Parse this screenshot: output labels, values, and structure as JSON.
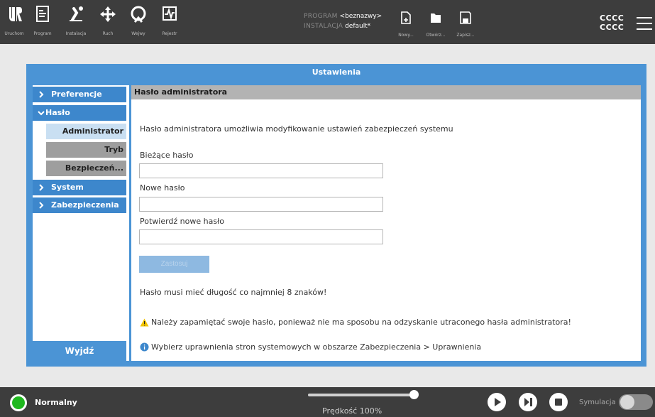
{
  "topbar": {
    "nav": [
      {
        "label": "Uruchom",
        "icon": "robot-logo-icon"
      },
      {
        "label": "Program",
        "icon": "program-icon"
      },
      {
        "label": "Instalacja",
        "icon": "installation-icon"
      },
      {
        "label": "Ruch",
        "icon": "move-icon"
      },
      {
        "label": "Wejwy",
        "icon": "io-icon"
      },
      {
        "label": "Rejestr",
        "icon": "log-icon"
      }
    ],
    "program_key": "PROGRAM",
    "program_value": "<beznazwy>",
    "installation_key": "INSTALACJA",
    "installation_value": "default*",
    "file_buttons": [
      {
        "label": "Nowy...",
        "icon": "new-file-icon"
      },
      {
        "label": "Otwórz...",
        "icon": "open-folder-icon"
      },
      {
        "label": "Zapisz...",
        "icon": "save-icon"
      }
    ],
    "user_line1": "CCCC",
    "user_line2": "CCCC"
  },
  "dialog": {
    "title": "Ustawienia",
    "sidebar": {
      "items": [
        {
          "label": "Preferencje",
          "expanded": false
        },
        {
          "label": "Hasło",
          "expanded": true
        },
        {
          "label": "System",
          "expanded": false
        },
        {
          "label": "Zabezpieczenia",
          "expanded": false
        }
      ],
      "subitems": [
        "Administrator",
        "Tryb",
        "Bezpieczeń..."
      ],
      "active_subitem": "Administrator",
      "exit_label": "Wyjdź"
    },
    "content": {
      "header": "Hasło administratora",
      "description": "Hasło administratora umożliwia modyfikowanie ustawień zabezpieczeń systemu",
      "current_password_label": "Bieżące hasło",
      "current_password_value": "",
      "new_password_label": "Nowe hasło",
      "new_password_value": "",
      "confirm_password_label": "Potwierdź nowe hasło",
      "confirm_password_value": "",
      "apply_label": "Zastosuj",
      "min_length_note": "Hasło musi mieć długość co najmniej 8 znaków!",
      "warning_note": "Należy zapamiętać swoje hasło, ponieważ nie ma sposobu na odzyskanie utraconego hasła administratora!",
      "info_note": "Wybierz uprawnienia stron systemowych w obszarze Zabezpieczenia > Uprawnienia"
    }
  },
  "bottombar": {
    "status": "Normalny",
    "status_color": "#1fb81f",
    "speed_label": "Prędkość 100%",
    "speed_value": 1.0,
    "simulation_label": "Symulacja",
    "simulation_on": false
  },
  "colors": {
    "accent": "#4b94d5",
    "topbar_bg": "#3d3d3d",
    "sidebar_item": "#3d87cc",
    "warning": "#f2c400",
    "info": "#3d87cc"
  }
}
